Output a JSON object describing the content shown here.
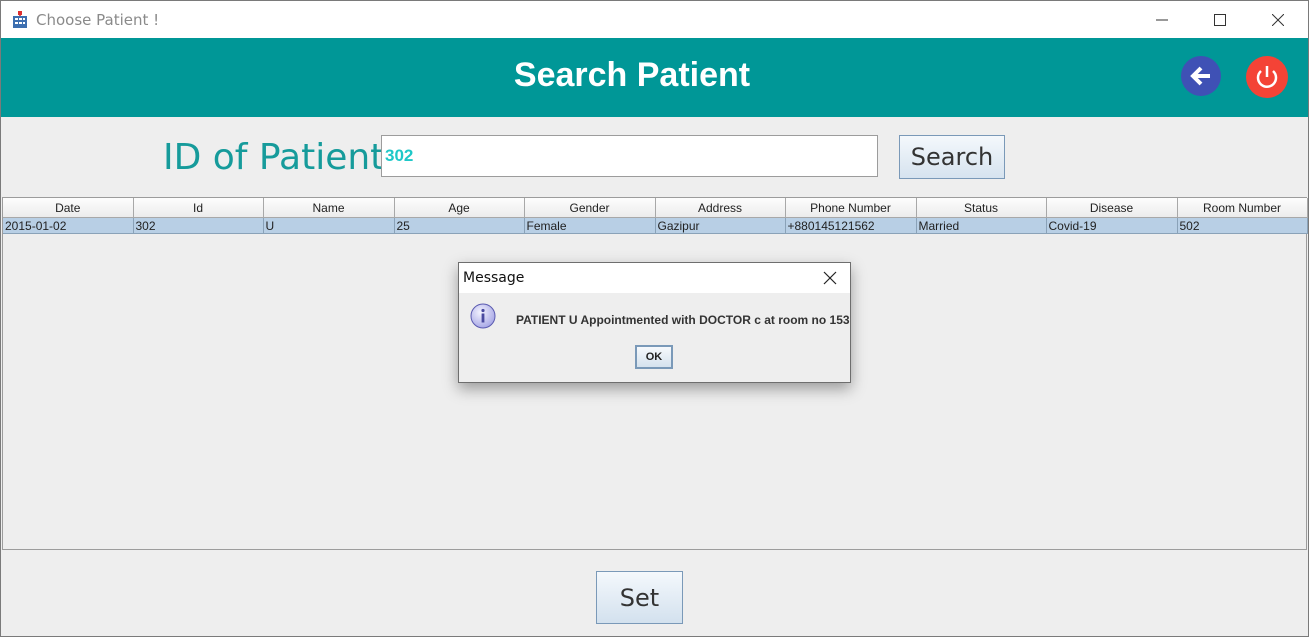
{
  "window": {
    "title": "Choose Patient !"
  },
  "header": {
    "title": "Search Patient"
  },
  "search": {
    "label": "ID of Patient",
    "value": "302",
    "button_label": "Search"
  },
  "table": {
    "columns": [
      "Date",
      "Id",
      "Name",
      "Age",
      "Gender",
      "Address",
      "Phone Number",
      "Status",
      "Disease",
      "Room Number"
    ],
    "rows": [
      [
        "2015-01-02",
        "302",
        "U",
        "25",
        "Female",
        "Gazipur",
        "+880145121562",
        "Married",
        "Covid-19",
        "502"
      ]
    ]
  },
  "dialog": {
    "title": "Message",
    "message": "PATIENT U Appointmented with DOCTOR c at room no 153",
    "ok_label": "OK"
  },
  "footer": {
    "set_label": "Set"
  },
  "icons": {
    "app": "hospital-icon",
    "minimize": "minimize-icon",
    "maximize": "maximize-icon",
    "close": "close-icon",
    "back": "arrow-left-icon",
    "power": "power-icon",
    "info": "info-icon"
  },
  "colors": {
    "header_bg": "#009797",
    "back_button": "#3f51b5",
    "power_button": "#f44336",
    "label_text": "#169b9b",
    "input_text": "#1ec8c8",
    "row_selected": "#b8cfe5"
  }
}
